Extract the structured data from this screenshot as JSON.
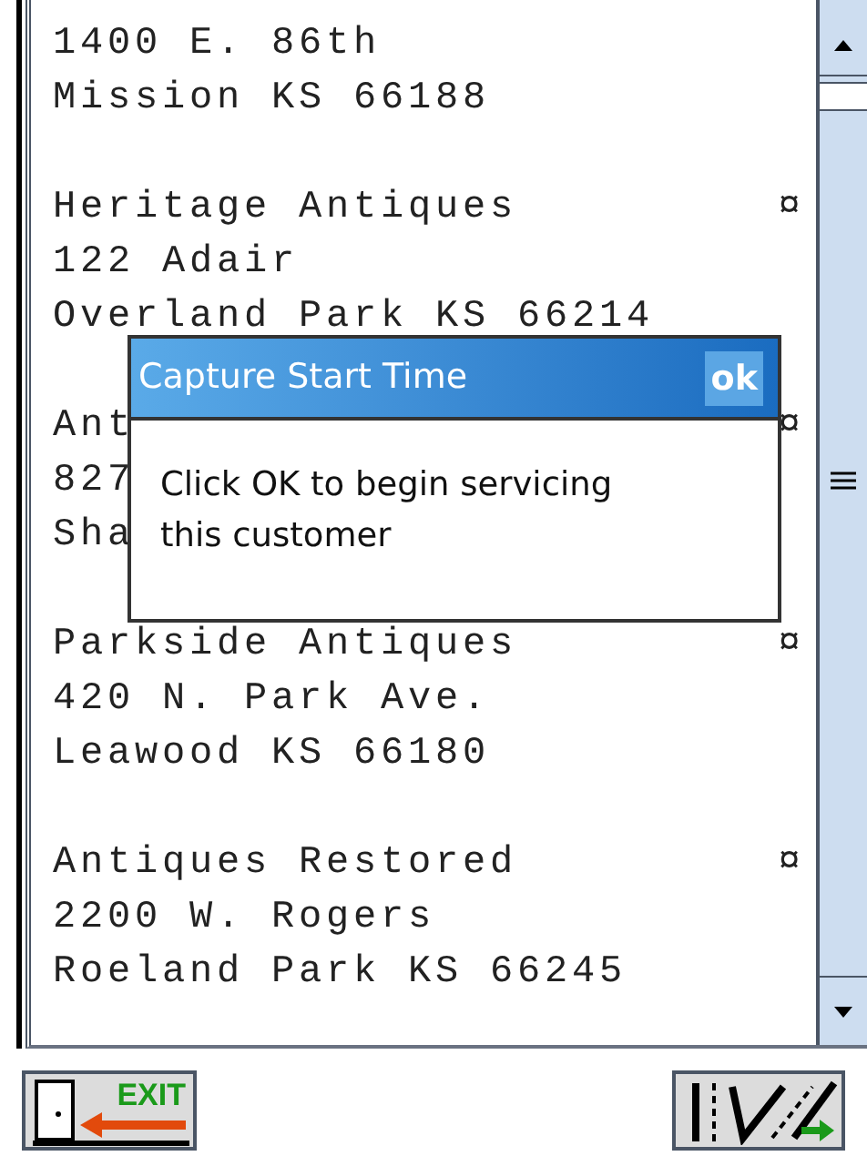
{
  "records": [
    {
      "lines": [
        "1400 E. 86th",
        "Mission KS 66188"
      ]
    },
    {
      "lines": [
        "Heritage Antiques",
        "122 Adair",
        "Overland Park KS 66214"
      ],
      "mark": "¤"
    },
    {
      "lines": [
        "Ant",
        "827",
        "Sha"
      ],
      "mark": "¤"
    },
    {
      "lines": [
        "Parkside Antiques",
        "420 N. Park Ave.",
        "Leawood KS 66180"
      ],
      "mark": "¤"
    },
    {
      "lines": [
        "Antiques Restored",
        "2200 W. Rogers",
        "Roeland Park KS 66245"
      ],
      "mark": "¤"
    }
  ],
  "dialog": {
    "title": "Capture Start Time",
    "ok": "ok",
    "message": "Click OK to begin servicing this customer"
  },
  "toolbar": {
    "exit_label": "EXIT"
  }
}
